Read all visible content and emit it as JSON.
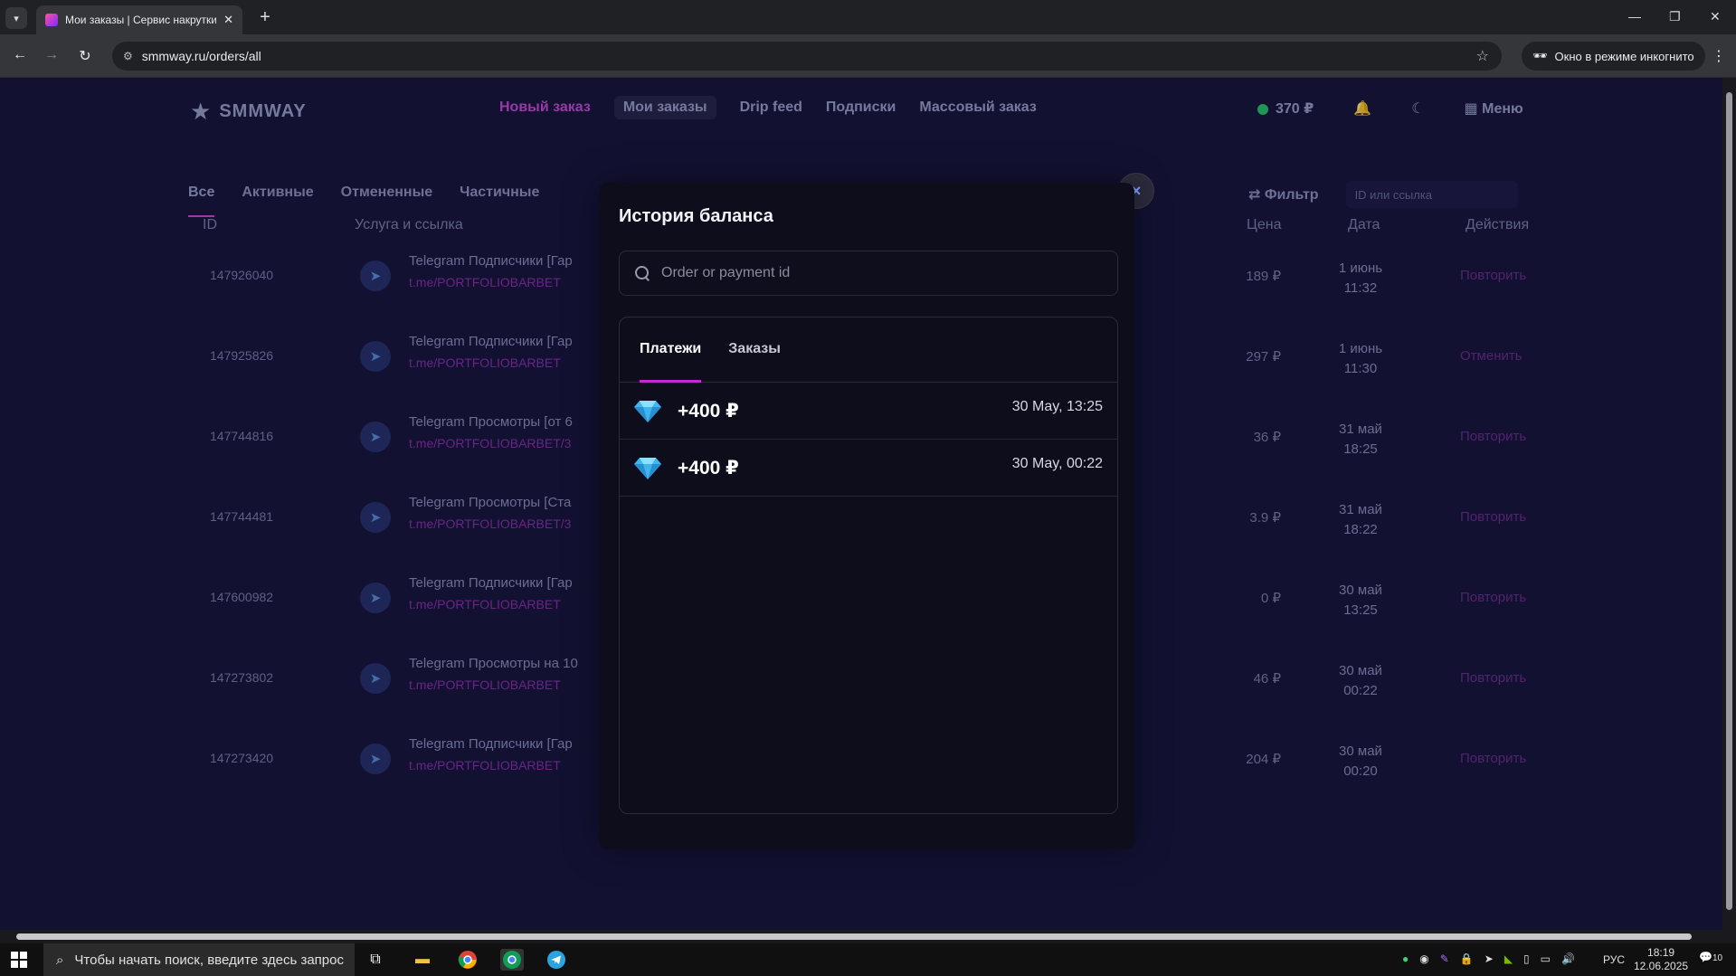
{
  "browser": {
    "tab_title": "Мои заказы | Сервис накрутки",
    "url": "smmway.ru/orders/all",
    "incognito_label": "Окно в режиме инкогнито"
  },
  "site": {
    "logo": "SMMWAY",
    "nav": [
      "Новый заказ",
      "Мои заказы",
      "Drip feed",
      "Подписки",
      "Массовый заказ"
    ],
    "balance": "370 ₽",
    "menu": "Меню",
    "filters": [
      "Все",
      "Активные",
      "Отмененные",
      "Частичные"
    ],
    "filter_label": "Фильтр",
    "filter_placeholder": "ID или ссылка",
    "columns": {
      "id": "ID",
      "service": "Услуга и ссылка",
      "price": "Цена",
      "date": "Дата",
      "actions": "Действия"
    },
    "orders": [
      {
        "id": "147926040",
        "title": "Telegram Подписчики [Гар",
        "link": "t.me/PORTFOLIOBARBET",
        "price": "189 ₽",
        "date1": "1 июнь",
        "date2": "11:32",
        "action": "Повторить"
      },
      {
        "id": "147925826",
        "title": "Telegram Подписчики [Гар",
        "link": "t.me/PORTFOLIOBARBET",
        "price": "297 ₽",
        "date1": "1 июнь",
        "date2": "11:30",
        "action": "Отменить"
      },
      {
        "id": "147744816",
        "title": "Telegram Просмотры [от 6",
        "link": "t.me/PORTFOLIOBARBET/3",
        "price": "36 ₽",
        "date1": "31 май",
        "date2": "18:25",
        "action": "Повторить"
      },
      {
        "id": "147744481",
        "title": "Telegram Просмотры [Ста",
        "link": "t.me/PORTFOLIOBARBET/3",
        "price": "3.9 ₽",
        "date1": "31 май",
        "date2": "18:22",
        "action": "Повторить"
      },
      {
        "id": "147600982",
        "title": "Telegram Подписчики [Гар",
        "link": "t.me/PORTFOLIOBARBET",
        "price": "0 ₽",
        "date1": "30 май",
        "date2": "13:25",
        "action": "Повторить"
      },
      {
        "id": "147273802",
        "title": "Telegram Просмотры на 10",
        "link": "t.me/PORTFOLIOBARBET",
        "price": "46 ₽",
        "date1": "30 май",
        "date2": "00:22",
        "action": "Повторить"
      },
      {
        "id": "147273420",
        "title": "Telegram Подписчики [Гар",
        "link": "t.me/PORTFOLIOBARBET",
        "price": "204 ₽",
        "date1": "30 май",
        "date2": "00:20",
        "action": "Повторить"
      }
    ]
  },
  "modal": {
    "title": "История баланса",
    "close": "×",
    "search_placeholder": "Order or payment id",
    "tabs": [
      "Платежи",
      "Заказы"
    ],
    "payments": [
      {
        "amount": "+400 ₽",
        "date": "30 May, 13:25"
      },
      {
        "amount": "+400 ₽",
        "date": "30 May, 00:22"
      }
    ]
  },
  "taskbar": {
    "search": "Чтобы начать поиск, введите здесь запрос",
    "lang": "РУС",
    "time": "18:19",
    "date": "12.06.2025",
    "notifications": "10"
  }
}
